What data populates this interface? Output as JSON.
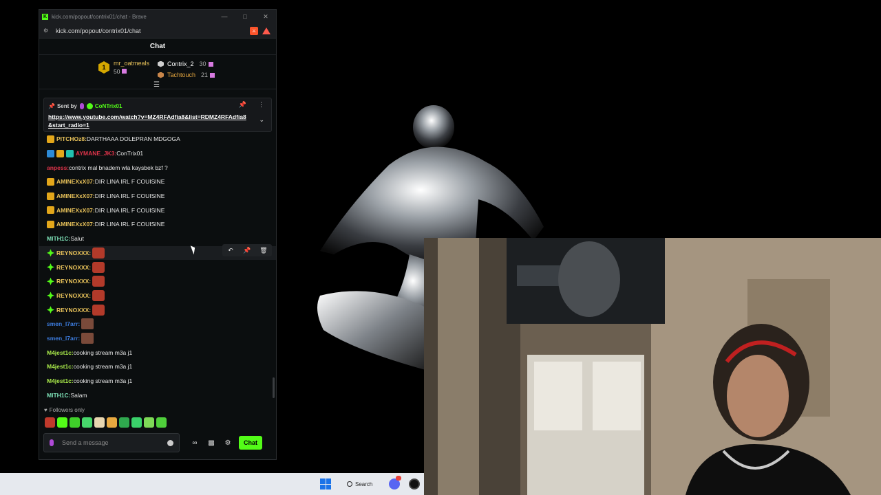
{
  "window": {
    "title": "kick.com/popout/contrix01/chat - Brave",
    "url": "kick.com/popout/contrix01/chat"
  },
  "chat": {
    "header": "Chat",
    "leaderboard": {
      "first": {
        "rank": "1",
        "name": "mr_oatmeals",
        "count": "50"
      },
      "second": {
        "name": "Contrix_2",
        "count": "30"
      },
      "third": {
        "name": "Tachtouch",
        "count": "21"
      }
    },
    "pinned": {
      "sent_by": "Sent by",
      "author": "CoNTrix01",
      "link": "https://www.youtube.com/watch?v=MZ4RFAdfia8&list=RDMZ4RFAdfia8&start_radio=1"
    },
    "messages": [
      {
        "user": "PITCHOz8:",
        "text": " DARTHAAA DOLEPRAN MDGOGA",
        "color": "#e8c25a",
        "badges": [
          "crown"
        ]
      },
      {
        "user": "AYMANE_JK3:",
        "text": " ConTrix01",
        "color": "#e0344a",
        "badges": [
          "blue",
          "crown",
          "teal"
        ]
      },
      {
        "user": "anpess:",
        "text": " contrix mal bnadem wla kaysbek bzf ?",
        "color": "#e0344a",
        "badges": []
      },
      {
        "user": "AMINEXxX07:",
        "text": " DIR LINA IRL F COUISINE",
        "color": "#e8c25a",
        "badges": [
          "crown"
        ]
      },
      {
        "user": "AMINEXxX07:",
        "text": " DIR LINA IRL F COUISINE",
        "color": "#e8c25a",
        "badges": [
          "crown"
        ]
      },
      {
        "user": "AMINEXxX07:",
        "text": " DIR LINA IRL F COUISINE",
        "color": "#e8c25a",
        "badges": [
          "crown"
        ]
      },
      {
        "user": "AMINEXxX07:",
        "text": " DIR LINA IRL F COUISINE",
        "color": "#e8c25a",
        "badges": [
          "crown"
        ]
      },
      {
        "user": "MITH1C:",
        "text": " Salut",
        "color": "#7ee2b8",
        "badges": []
      },
      {
        "user": "REYNOXXX:",
        "text": "",
        "color": "#e8c25a",
        "badges": [
          "green"
        ],
        "emote": "red"
      },
      {
        "user": "REYNOXXX:",
        "text": "",
        "color": "#e8c25a",
        "badges": [
          "green"
        ],
        "emote": "red"
      },
      {
        "user": "REYNOXXX:",
        "text": "",
        "color": "#e8c25a",
        "badges": [
          "green"
        ],
        "emote": "red"
      },
      {
        "user": "REYNOXXX:",
        "text": "",
        "color": "#e8c25a",
        "badges": [
          "green"
        ],
        "emote": "red"
      },
      {
        "user": "REYNOXXX:",
        "text": "",
        "color": "#e8c25a",
        "badges": [
          "green"
        ],
        "emote": "red"
      },
      {
        "user": "smen_l7arr:",
        "text": "",
        "color": "#3d7de0",
        "badges": [],
        "emote": "brown"
      },
      {
        "user": "smen_l7arr:",
        "text": "",
        "color": "#3d7de0",
        "badges": [],
        "emote": "brown"
      },
      {
        "user": "M4jest1c:",
        "text": " cooking stream m3a j1",
        "color": "#a8e84a",
        "badges": []
      },
      {
        "user": "M4jest1c:",
        "text": " cooking stream m3a j1",
        "color": "#a8e84a",
        "badges": []
      },
      {
        "user": "M4jest1c:",
        "text": " cooking stream m3a j1",
        "color": "#a8e84a",
        "badges": []
      },
      {
        "user": "MITH1C:",
        "text": " Salam",
        "color": "#7ee2b8",
        "badges": []
      }
    ],
    "followers_only": "Followers only",
    "input_placeholder": "Send a message",
    "send_label": "Chat"
  },
  "taskbar": {
    "search_label": "Search"
  },
  "colors": {
    "accent": "#53fc18",
    "background": "#0b0e0f"
  }
}
